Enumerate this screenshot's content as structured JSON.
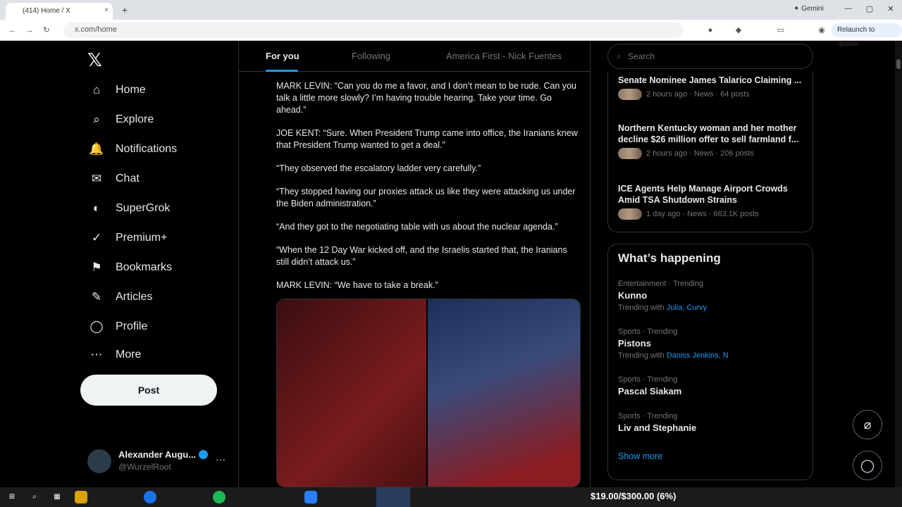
{
  "browser": {
    "tab_title": "(414) Home / X",
    "new_tab": "+",
    "tab_close": "×",
    "gemini_label": "✦ Gemini",
    "omnibox_text": "x.com/home",
    "relaunch_label": "Relaunch to update",
    "controls": {
      "minimize": "—",
      "maximize": "▢",
      "close": "✕"
    }
  },
  "leftnav": {
    "logo": "𝕏",
    "items": [
      {
        "label": "Home",
        "icon": "⌂"
      },
      {
        "label": "Explore",
        "icon": "⌕"
      },
      {
        "label": "Notifications",
        "icon": "🔔"
      },
      {
        "label": "Chat",
        "icon": "✉"
      },
      {
        "label": "SuperGrok",
        "icon": "◐"
      },
      {
        "label": "Premium+",
        "icon": "✓"
      },
      {
        "label": "Bookmarks",
        "icon": "⚑"
      },
      {
        "label": "Articles",
        "icon": "✎"
      },
      {
        "label": "Profile",
        "icon": "◯"
      },
      {
        "label": "More",
        "icon": "⋯"
      }
    ],
    "post_label": "Post",
    "account": {
      "name": "Alexander Augu...",
      "handle": "@WurzelRoot",
      "more": "···"
    }
  },
  "feed": {
    "tabs": [
      "For you",
      "Following",
      "America First - Nick Fuentes"
    ],
    "paragraphs": [
      "MARK LEVIN: “Can you do me a favor, and I don’t mean to be rude. Can you talk a little more slowly? I’m having trouble hearing. Take your time. Go ahead.”",
      "JOE KENT: “Sure. When President Trump came into office, the Iranians knew that President Trump wanted to get a deal.”",
      "“They observed the escalatory ladder very carefully.”",
      "“They stopped having our proxies attack us like they were attacking us under the Biden administration.”",
      "“And they got to the negotiating table with us about the nuclear agenda.”",
      "“When the 12 Day War kicked off, and the Israelis started that, the Iranians still didn’t attack us.”",
      "MARK LEVIN: “We have to take a break.”"
    ]
  },
  "right": {
    "search_placeholder": "Search",
    "news": [
      {
        "title": "Senate Nominee James Talarico Claiming ...",
        "meta": "2 hours ago · News · 64 posts"
      },
      {
        "title": "Northern Kentucky woman and her mother decline $26 million offer to sell farmland f...",
        "meta": "2 hours ago · News · 206 posts"
      },
      {
        "title": "ICE Agents Help Manage Airport Crowds Amid TSA Shutdown Strains",
        "meta": "1 day ago · News · 663.1K posts"
      }
    ],
    "happening_title": "What’s happening",
    "trends": [
      {
        "category": "Entertainment · Trending",
        "name": "Kunno",
        "with_label": "Trending with",
        "with": "Julia, Curvy"
      },
      {
        "category": "Sports · Trending",
        "name": "Pistons",
        "with_label": "Trending with",
        "with": "Daniss Jenkins, N"
      },
      {
        "category": "Sports · Trending",
        "name": "Pascal Siakam",
        "with_label": "",
        "with": ""
      },
      {
        "category": "Sports · Trending",
        "name": "Liv and Stephanie",
        "with_label": "",
        "with": ""
      }
    ],
    "show_more": "Show more"
  },
  "fabs": {
    "grok": "⌀",
    "messages": "◯"
  },
  "taskbar": {
    "donation": "$19.00/$300.00 (6%)"
  }
}
